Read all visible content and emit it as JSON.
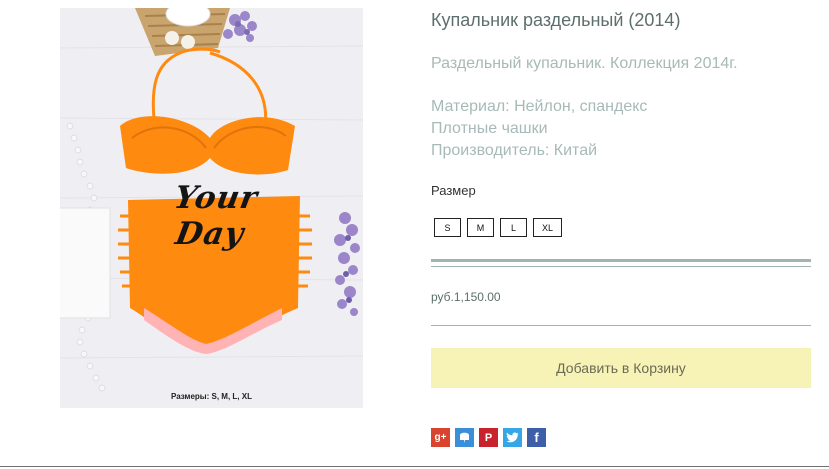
{
  "product": {
    "title": "Купальник раздельный (2014)",
    "description": "Раздельный купальник. Коллекция 2014г.",
    "specs": [
      "Материал: Нейлон, спандекс",
      "Плотные чашки",
      "Производитель: Китай"
    ],
    "size_label": "Размер",
    "sizes": [
      "S",
      "M",
      "L",
      "XL"
    ],
    "price": "руб.1,150.00",
    "add_to_cart": "Добавить в Корзину"
  },
  "image": {
    "brand_text": "Your Day",
    "caption": "Размеры: S, M, L, XL",
    "swimsuit_color": "#ff8a10"
  },
  "share": {
    "icons": [
      "google-plus-icon",
      "mail-icon",
      "pinterest-icon",
      "twitter-icon",
      "facebook-icon"
    ],
    "colors": {
      "google_plus": "#d8442e",
      "mail": "#3b8fd8",
      "pinterest": "#c8232c",
      "twitter": "#36a6e6",
      "facebook": "#3d5fa8"
    }
  },
  "colors": {
    "accent": "#f7f2b5",
    "heading": "#5d6f6c",
    "muted_text": "#a7bab7",
    "divider": "#a2b4b0"
  }
}
